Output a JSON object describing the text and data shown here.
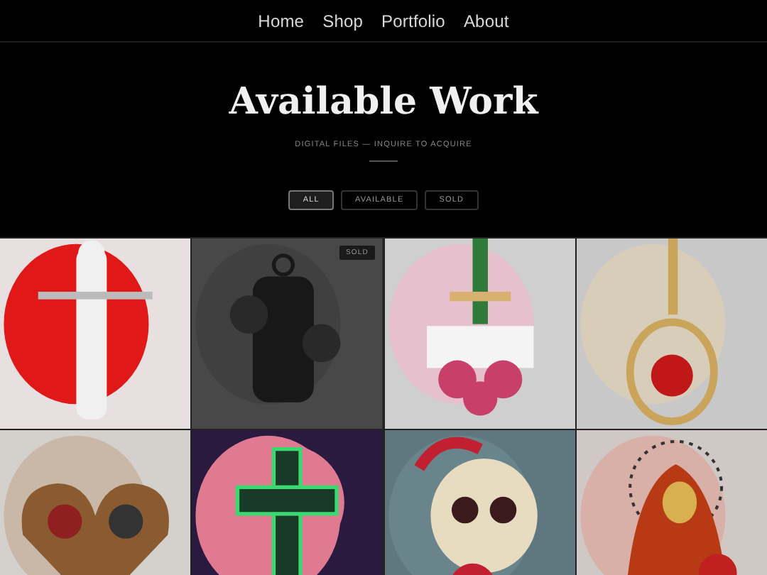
{
  "nav": [
    {
      "label": "Home"
    },
    {
      "label": "Shop"
    },
    {
      "label": "Portfolio"
    },
    {
      "label": "About"
    }
  ],
  "header": {
    "title": "Available Work",
    "subtitle": "DIGITAL FILES — INQUIRE TO ACQUIRE"
  },
  "filters": [
    {
      "label": "ALL",
      "selected": true
    },
    {
      "label": "AVAILABLE",
      "selected": false
    },
    {
      "label": "SOLD",
      "selected": false
    }
  ],
  "gallery": [
    {
      "kind": "picture",
      "sold": false
    },
    {
      "kind": "picture",
      "sold": true,
      "badge": "SOLD"
    },
    {
      "kind": "picture",
      "sold": false
    },
    {
      "kind": "picture",
      "sold": false
    },
    {
      "kind": "picture",
      "sold": false
    },
    {
      "kind": "picture",
      "sold": false
    },
    {
      "kind": "picture",
      "sold": false
    },
    {
      "kind": "picture",
      "sold": false
    }
  ]
}
